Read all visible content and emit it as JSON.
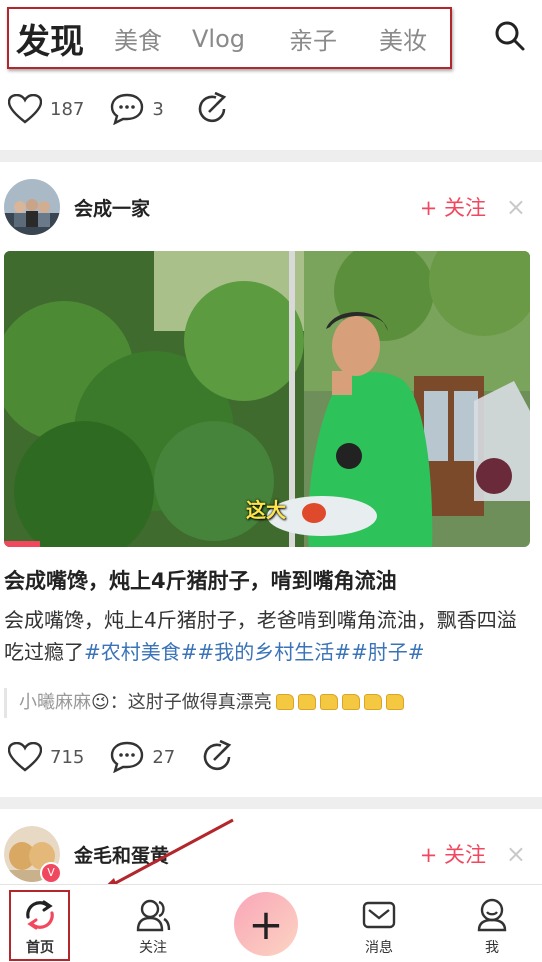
{
  "tabs": {
    "active": "发现",
    "items": [
      "美食",
      "Vlog",
      "亲子",
      "美妆"
    ]
  },
  "prev_post": {
    "likes": "187",
    "comments": "3"
  },
  "post": {
    "author": "会成一家",
    "follow_label": "+ 关注",
    "close": "×",
    "subtitle": "这大",
    "title": "会成嘴馋，炖上4斤猪肘子，啃到嘴角流油",
    "desc_text": "会成嘴馋，炖上4斤猪肘子，老爸啃到嘴角流油，飘香四溢吃过瘾了",
    "desc_tags": "#农村美食##我的乡村生活##肘子#",
    "comment_user": "小曦麻麻",
    "comment_emoji": "😉",
    "comment_text": "：这肘子做得真漂亮",
    "likes": "715",
    "comments": "27"
  },
  "next_post": {
    "author": "金毛和蛋黄",
    "follow_label": "+ 关注",
    "close": "×"
  },
  "nav": {
    "home": "首页",
    "follow": "关注",
    "plus": "+",
    "messages": "消息",
    "me": "我"
  },
  "colors": {
    "accent": "#f2485f",
    "tag": "#3a73b7",
    "annotation": "#b3262b"
  }
}
